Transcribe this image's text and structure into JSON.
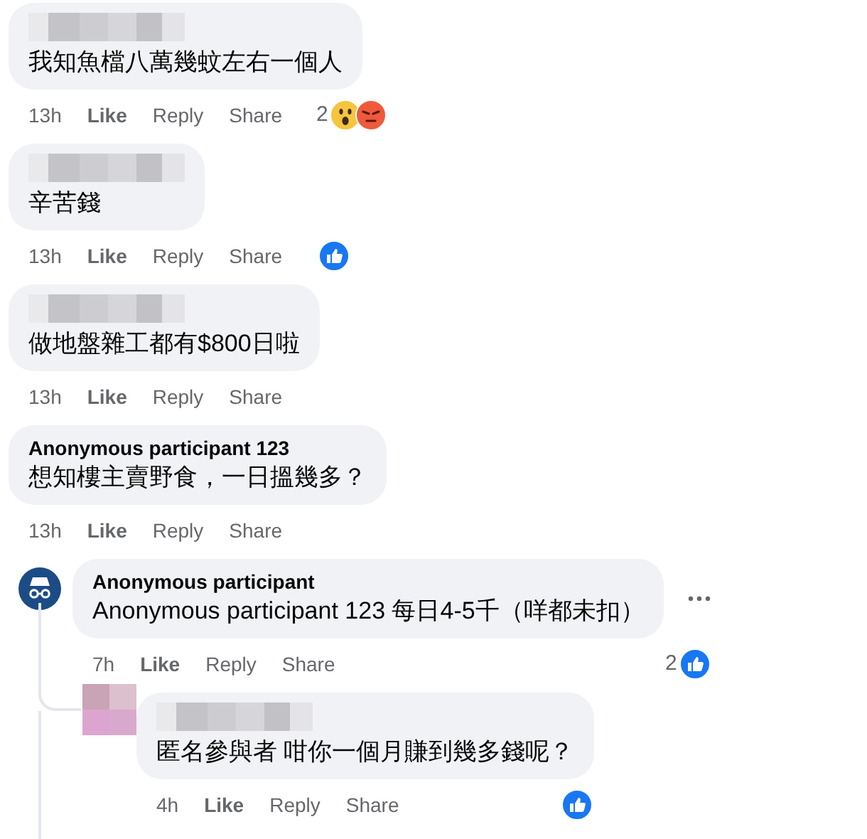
{
  "comments": [
    {
      "kind": "comment",
      "text": "我知魚檔八萬幾蚊左右一個人",
      "time": "13h",
      "actions": [
        "Like",
        "Reply",
        "Share"
      ],
      "reaction_count": "2",
      "reactions": [
        {
          "kind": "wow"
        },
        {
          "kind": "angry"
        }
      ]
    },
    {
      "kind": "comment",
      "text": "辛苦錢",
      "time": "13h",
      "actions": [
        "Like",
        "Reply",
        "Share"
      ],
      "reactions": [
        {
          "kind": "like"
        }
      ]
    },
    {
      "kind": "comment",
      "text": "做地盤雜工都有$800日啦",
      "time": "13h",
      "actions": [
        "Like",
        "Reply",
        "Share"
      ]
    },
    {
      "kind": "comment",
      "author": "Anonymous participant 123",
      "text": "想知樓主賣野食，一日搵幾多？",
      "time": "13h",
      "actions": [
        "Like",
        "Reply",
        "Share"
      ]
    },
    {
      "kind": "reply",
      "author": "Anonymous participant",
      "text": "Anonymous participant 123 每日4-5千（咩都未扣）",
      "time": "7h",
      "actions": [
        "Like",
        "Reply",
        "Share"
      ],
      "reaction_count": "2",
      "reactions": [
        {
          "kind": "like"
        }
      ],
      "more_button": true
    },
    {
      "kind": "nested_reply",
      "text": "匿名參與者 咁你一個月賺到幾多錢呢？",
      "time": "4h",
      "actions": [
        "Like",
        "Reply",
        "Share"
      ],
      "reactions": [
        {
          "kind": "like"
        }
      ]
    }
  ]
}
